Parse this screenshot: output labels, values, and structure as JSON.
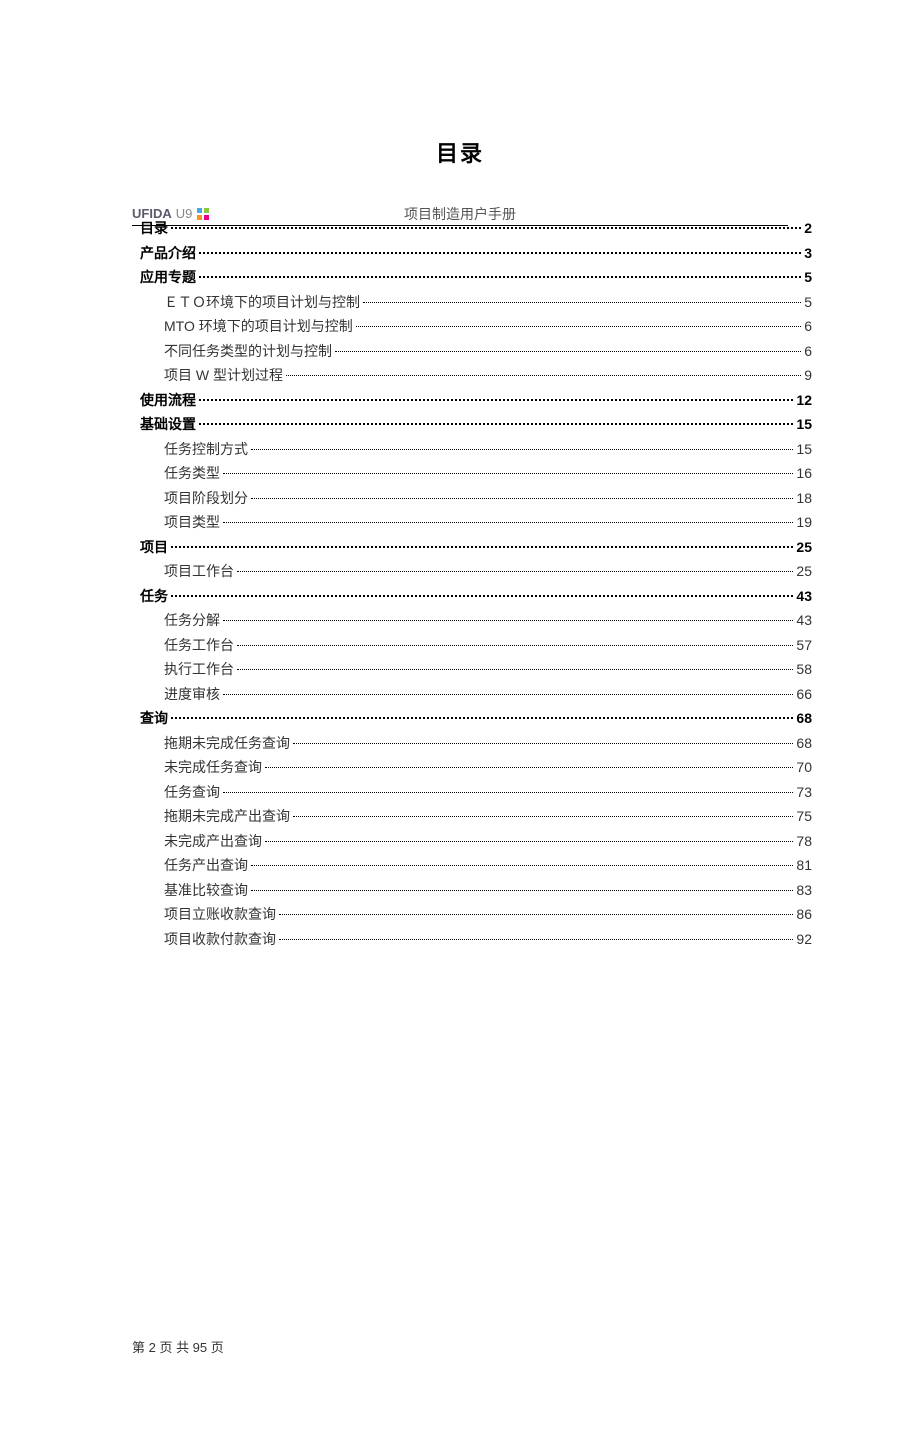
{
  "header": {
    "logo_main": "UFIDA",
    "logo_sub": "U9",
    "doc_title": "项目制造用户手册"
  },
  "title": "目录",
  "toc": [
    {
      "label": "目录",
      "page": "2",
      "level": 0
    },
    {
      "label": "产品介绍",
      "page": "3",
      "level": 0
    },
    {
      "label": "应用专题",
      "page": "5",
      "level": 0
    },
    {
      "label": "ＥＴＯ环境下的项目计划与控制",
      "page": "5",
      "level": 1
    },
    {
      "label": "MTO 环境下的项目计划与控制",
      "page": "6",
      "level": 1
    },
    {
      "label": "不同任务类型的计划与控制",
      "page": "6",
      "level": 1
    },
    {
      "label": "项目 W 型计划过程",
      "page": "9",
      "level": 1
    },
    {
      "label": "使用流程",
      "page": "12",
      "level": 0
    },
    {
      "label": "基础设置",
      "page": "15",
      "level": 0
    },
    {
      "label": "任务控制方式",
      "page": "15",
      "level": 1
    },
    {
      "label": "任务类型",
      "page": "16",
      "level": 1
    },
    {
      "label": "项目阶段划分",
      "page": "18",
      "level": 1
    },
    {
      "label": "项目类型",
      "page": "19",
      "level": 1
    },
    {
      "label": "项目",
      "page": "25",
      "level": 0
    },
    {
      "label": "项目工作台",
      "page": "25",
      "level": 1
    },
    {
      "label": "任务",
      "page": "43",
      "level": 0
    },
    {
      "label": "任务分解",
      "page": "43",
      "level": 1
    },
    {
      "label": "任务工作台",
      "page": "57",
      "level": 1
    },
    {
      "label": "执行工作台",
      "page": "58",
      "level": 1
    },
    {
      "label": "进度审核",
      "page": "66",
      "level": 1
    },
    {
      "label": "查询",
      "page": "68",
      "level": 0
    },
    {
      "label": "拖期未完成任务查询",
      "page": "68",
      "level": 1
    },
    {
      "label": "未完成任务查询",
      "page": "70",
      "level": 1
    },
    {
      "label": "任务查询",
      "page": "73",
      "level": 1
    },
    {
      "label": "拖期未完成产出查询",
      "page": "75",
      "level": 1
    },
    {
      "label": "未完成产出查询",
      "page": "78",
      "level": 1
    },
    {
      "label": "任务产出查询",
      "page": "81",
      "level": 1
    },
    {
      "label": "基准比较查询",
      "page": "83",
      "level": 1
    },
    {
      "label": "项目立账收款查询",
      "page": "86",
      "level": 1
    },
    {
      "label": "项目收款付款查询",
      "page": "92",
      "level": 1
    }
  ],
  "footer": "第 2 页 共 95 页"
}
